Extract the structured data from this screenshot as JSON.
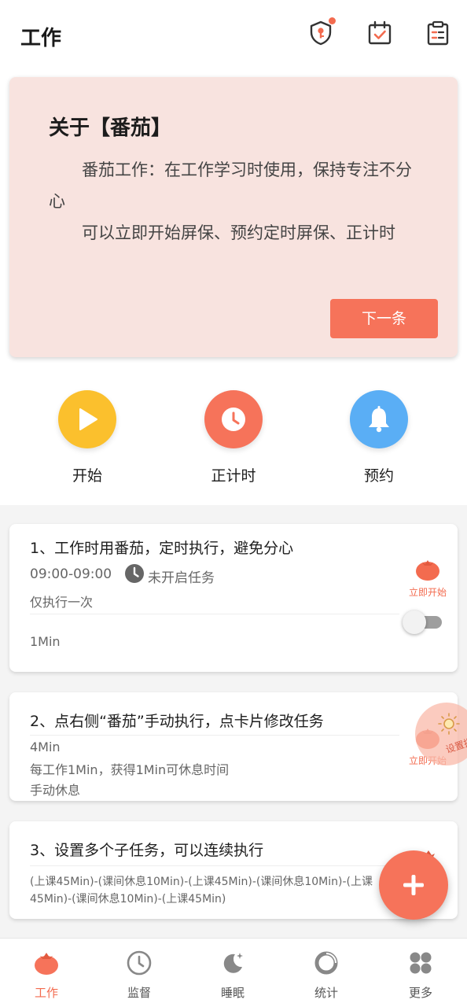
{
  "header": {
    "title": "工作",
    "icons": [
      "shield-key-icon",
      "calendar-check-icon",
      "clipboard-list-icon"
    ]
  },
  "about": {
    "title": "关于【番茄】",
    "paragraphs": [
      "番茄工作：在工作学习时使用，保持专注不分心",
      "可以立即开始屏保、预约定时屏保、正计时"
    ],
    "next_label": "下一条"
  },
  "actions": [
    {
      "label": "开始",
      "icon": "play-icon",
      "color": "#fbc02d"
    },
    {
      "label": "正计时",
      "icon": "clock-icon",
      "color": "#f6735a"
    },
    {
      "label": "预约",
      "icon": "bell-icon",
      "color": "#5aaef5"
    }
  ],
  "tasks": [
    {
      "title": "1、工作时用番茄，定时执行，避免分心",
      "time_range": "09:00-09:00",
      "status": "未开启任务",
      "repeat": "仅执行一次",
      "duration": "1Min",
      "start_label": "立即开始",
      "enabled": false
    },
    {
      "title": "2、点右侧“番茄”手动执行，点卡片修改任务",
      "duration": "4Min",
      "desc": "每工作1Min，获得1Min可休息时间",
      "rest": "手动休息",
      "start_label": "立即开始"
    },
    {
      "title": "3、设置多个子任务，可以连续执行",
      "sequence": "(上课45Min)-(课间休息10Min)-(上课45Min)-(课间休息10Min)-(上课45Min)-(课间休息10Min)-(上课45Min)"
    }
  ],
  "float_setting_label": "设置提醒",
  "nav": [
    {
      "label": "工作",
      "icon": "tomato-icon",
      "active": true
    },
    {
      "label": "监督",
      "icon": "clock-icon",
      "active": false
    },
    {
      "label": "睡眠",
      "icon": "moon-icon",
      "active": false
    },
    {
      "label": "统计",
      "icon": "ring-chart-icon",
      "active": false
    },
    {
      "label": "更多",
      "icon": "grid-icon",
      "active": false
    }
  ],
  "colors": {
    "accent": "#f6735a",
    "card_bg": "#f8e3df"
  }
}
